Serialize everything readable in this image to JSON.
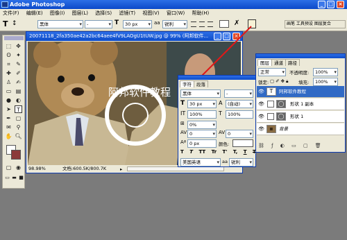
{
  "app": {
    "title": "Adobe Photoshop"
  },
  "menu": [
    "文件(F)",
    "编辑(E)",
    "图像(I)",
    "图层(L)",
    "选择(S)",
    "滤镜(T)",
    "视图(V)",
    "窗口(W)",
    "帮助(H)"
  ],
  "options": {
    "font_family": "黑体",
    "font_style": "-",
    "font_size": "30 px",
    "aa": "锐利",
    "palette_well": "画笔  工具预设  图层复合"
  },
  "document": {
    "title": "20071118_2fa350ae42a2bc64aee4fV9LAOgU1tUW.jpg @ 99% (阿邦软件...",
    "overlay_text": "阿邦软件教程",
    "zoom": "98.98%",
    "doc_size": "文档:600.5K/800.7K"
  },
  "character": {
    "tabs": [
      "字符",
      "段落"
    ],
    "font_family": "黑体",
    "font_style": "-",
    "size": "30 px",
    "leading": "(自动)",
    "v_scale": "100%",
    "h_scale": "100%",
    "tracking_pct": "0%",
    "kerning": "0",
    "tracking": "0",
    "baseline": "0 px",
    "color_label": "颜色:",
    "styles": [
      "T",
      "T",
      "TT",
      "Tr",
      "T'",
      "T,",
      "T",
      "T"
    ],
    "language": "美国英语",
    "aa": "锐利"
  },
  "layers": {
    "tabs": [
      "图层",
      "通道",
      "路径"
    ],
    "blend": "正常",
    "opacity_label": "不透明度:",
    "opacity": "100%",
    "lock_label": "锁定:",
    "fill_label": "填充:",
    "fill": "100%",
    "items": [
      {
        "name": "阿邦软件教程",
        "thumb": "T",
        "selected": true
      },
      {
        "name": "形状 1 副本",
        "thumb": "◯",
        "selected": false
      },
      {
        "name": "形状 1",
        "thumb": "◯",
        "selected": false
      },
      {
        "name": "背景",
        "thumb": "▪",
        "selected": false
      }
    ]
  }
}
